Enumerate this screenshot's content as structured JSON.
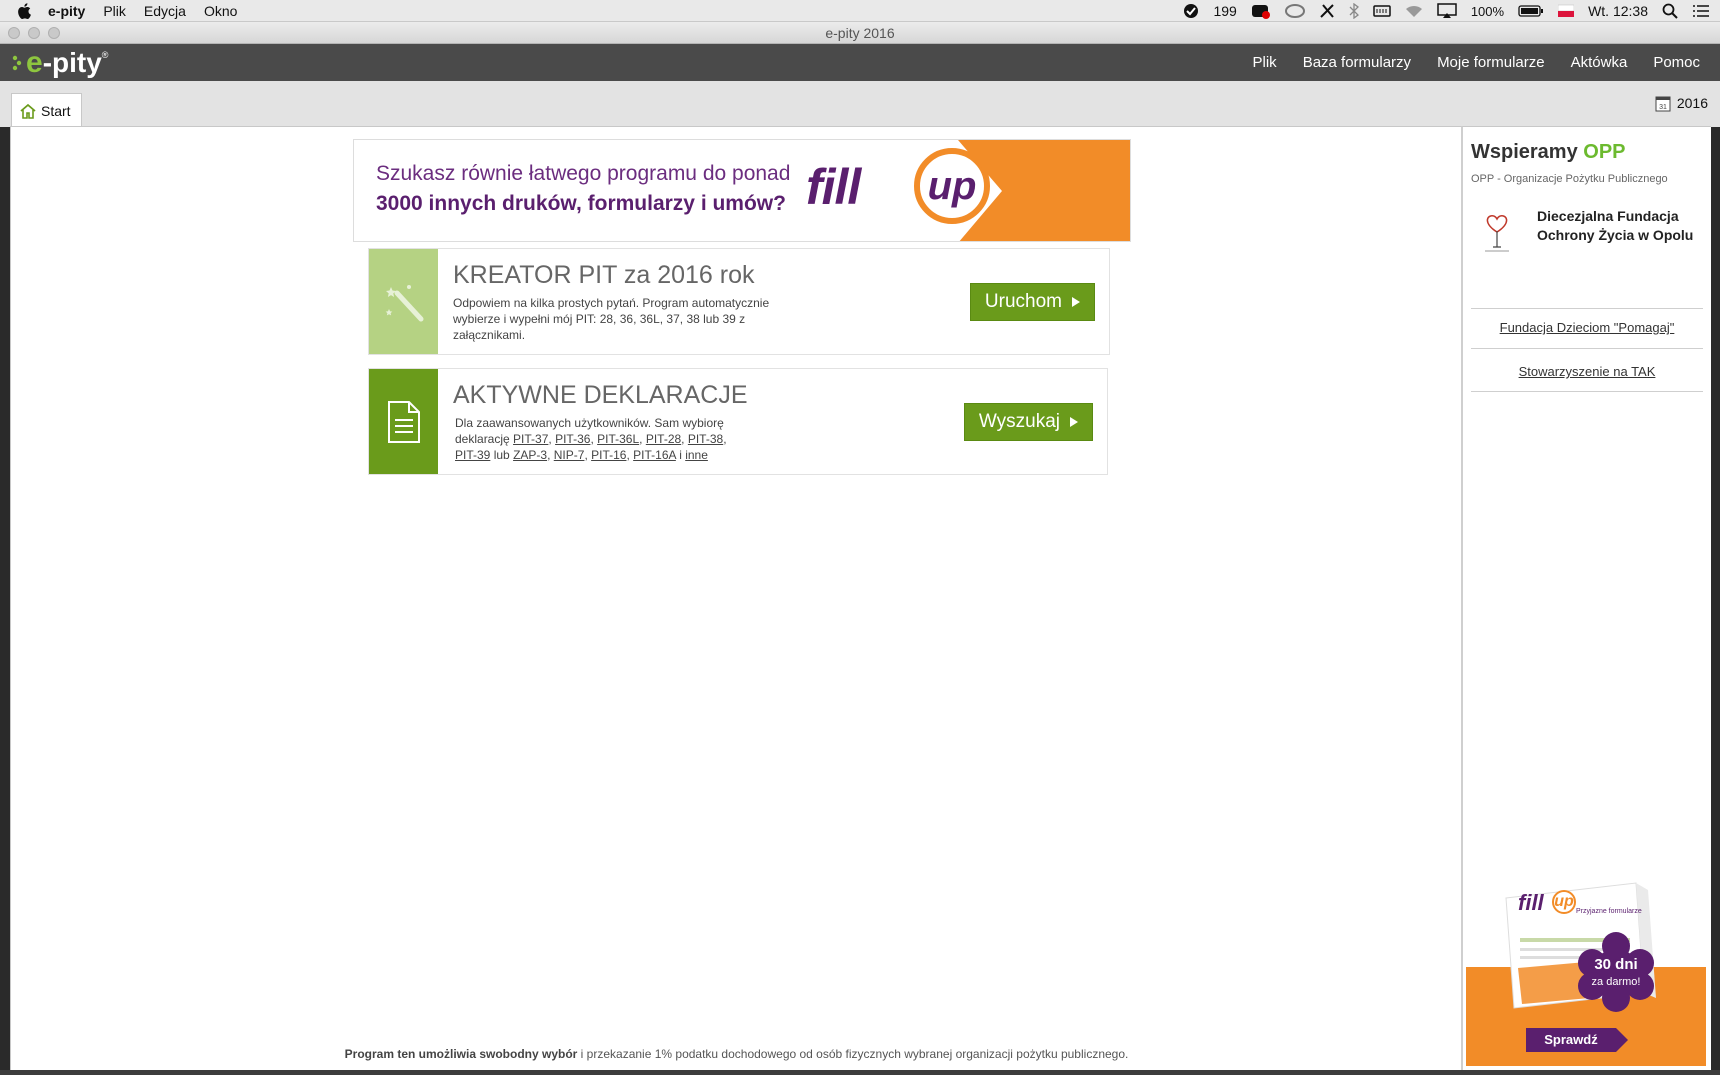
{
  "menubar": {
    "app": "e-pity",
    "items": [
      "Plik",
      "Edycja",
      "Okno"
    ],
    "status_count": "199",
    "battery": "100%",
    "clock": "Wt. 12:38"
  },
  "window": {
    "title": "e-pity 2016"
  },
  "header": {
    "logo": {
      "e": "e",
      "rest": "-pity",
      "reg": "®"
    },
    "nav": [
      "Plik",
      "Baza formularzy",
      "Moje formularze",
      "Aktówka",
      "Pomoc"
    ]
  },
  "tabs": {
    "start": "Start",
    "year": "2016",
    "calendar_day": "31"
  },
  "banner": {
    "line1": "Szukasz równie łatwego programu do ponad",
    "line2": "3000 innych druków, formularzy i umów?",
    "brand_fill": "fill",
    "brand_up": "up"
  },
  "cards": {
    "kreator": {
      "title": "KREATOR PIT za 2016 rok",
      "desc": "Odpowiem na kilka prostych pytań. Program automatycznie wybierze i wypełni mój PIT: 28, 36, 36L, 37, 38 lub 39 z załącznikami.",
      "button": "Uruchom"
    },
    "aktywne": {
      "title": "AKTYWNE DEKLARACJE",
      "desc_pre": "Dla zaawansowanych użytkowników. Sam wybiorę deklarację",
      "links": [
        "PIT-37",
        "PIT-36",
        "PIT-36L",
        "PIT-28",
        "PIT-38",
        "PIT-39"
      ],
      "lub": "lub",
      "links2": [
        "ZAP-3",
        "NIP-7",
        "PIT-16",
        "PIT-16A"
      ],
      "i": "i",
      "inne": "inne",
      "button": "Wyszukaj"
    }
  },
  "sidebar": {
    "heading_a": "Wspieramy",
    "heading_b": "OPP",
    "subtitle": "OPP - Organizacje Pożytku Publicznego",
    "featured_org": "Diecezjalna Fundacja Ochrony Życia w Opolu",
    "links": [
      "Fundacja Dzieciom \"Pomagaj\"",
      "Stowarzyszenie na TAK"
    ],
    "ad": {
      "brand": "fill",
      "brand_up": "up",
      "tagline": "Przyjazne formularze",
      "badge_big": "30 dni",
      "badge_small": "za darmo!",
      "cta": "Sprawdź"
    }
  },
  "footer": {
    "bold": "Program ten umożliwia swobodny wybór",
    "rest": " i przekazanie 1% podatku dochodowego od osób fizycznych wybranej organizacji pożytku publicznego."
  },
  "colors": {
    "green": "#6a9b1b",
    "orange": "#f28c28",
    "purple": "#5a1f6e",
    "opp_green": "#6cba2f"
  }
}
